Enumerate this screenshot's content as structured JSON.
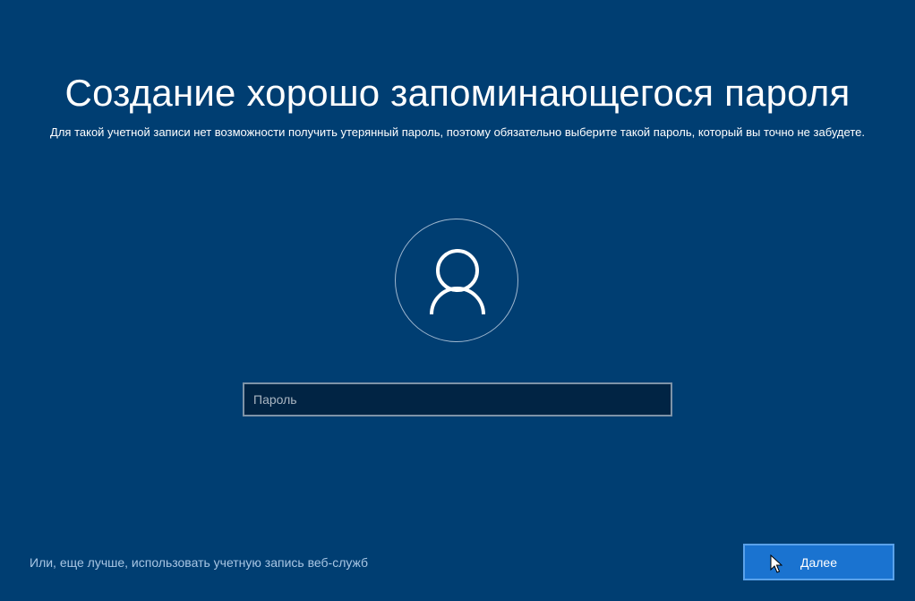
{
  "page": {
    "title": "Создание хорошо запоминающегося пароля",
    "subtitle": "Для такой учетной записи нет возможности получить утерянный пароль, поэтому обязательно выберите такой пароль, который вы точно не забудете."
  },
  "avatar": {
    "icon": "user-icon"
  },
  "password": {
    "placeholder": "Пароль",
    "value": ""
  },
  "footer": {
    "web_account_link": "Или, еще лучше, использовать учетную запись веб-служб",
    "next_label": "Далее"
  },
  "colors": {
    "background": "#003e72",
    "input_background": "#012444",
    "input_border": "#7e93a8",
    "button_background": "#1a73d0",
    "button_border": "#5aa2ea",
    "link": "#a8c6e4"
  }
}
